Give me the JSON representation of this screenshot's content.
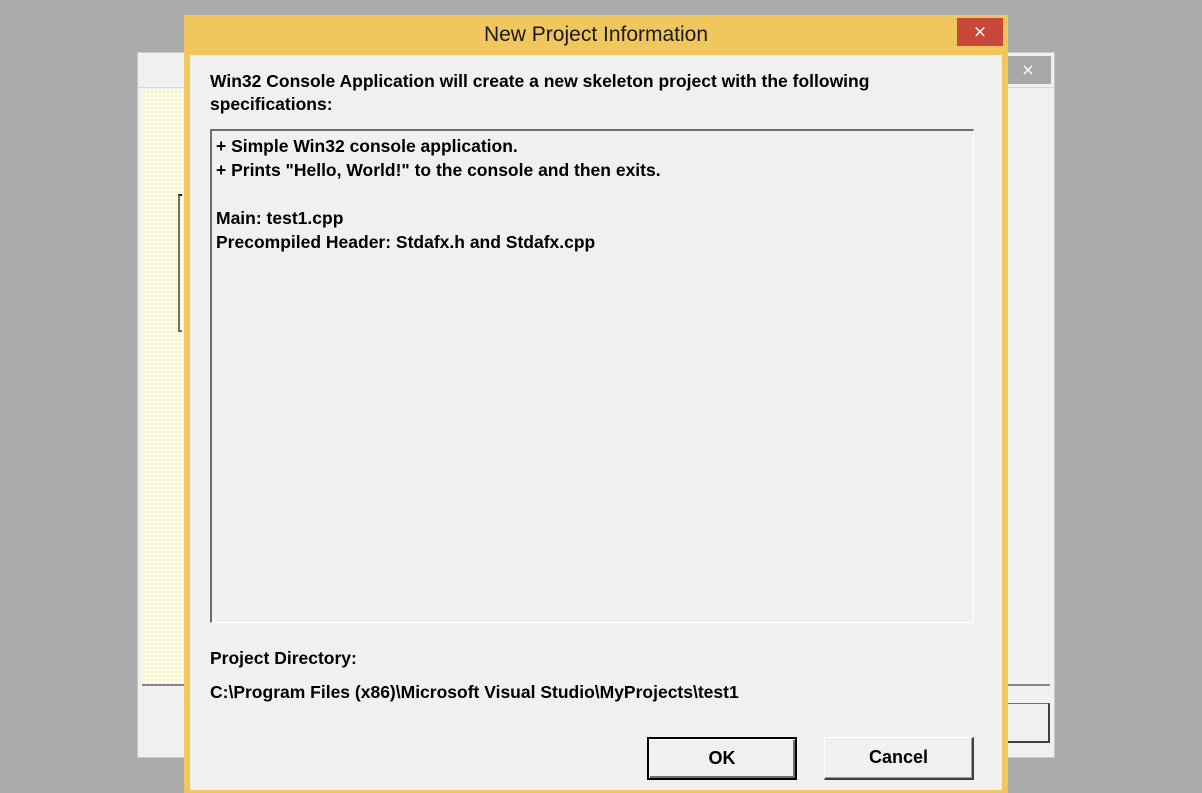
{
  "background_window": {
    "close_glyph": "×"
  },
  "dialog": {
    "title": "New Project Information",
    "close_glyph": "×",
    "description": "Win32 Console Application will create a new skeleton project with the following specifications:",
    "spec_lines": [
      "+ Simple Win32 console application.",
      "+ Prints \"Hello, World!\" to the console and then exits.",
      "",
      "Main: test1.cpp",
      "Precompiled Header: Stdafx.h and Stdafx.cpp"
    ],
    "project_directory_label": "Project Directory:",
    "project_directory_value": "C:\\Program Files (x86)\\Microsoft Visual Studio\\MyProjects\\test1",
    "ok_label": "OK",
    "cancel_label": "Cancel"
  },
  "colors": {
    "title_bar": "#f0c75c",
    "close_button": "#c7473a",
    "desktop": "#ababab",
    "dialog_face": "#f0f0f0"
  },
  "icons": {
    "close": "close-icon"
  }
}
